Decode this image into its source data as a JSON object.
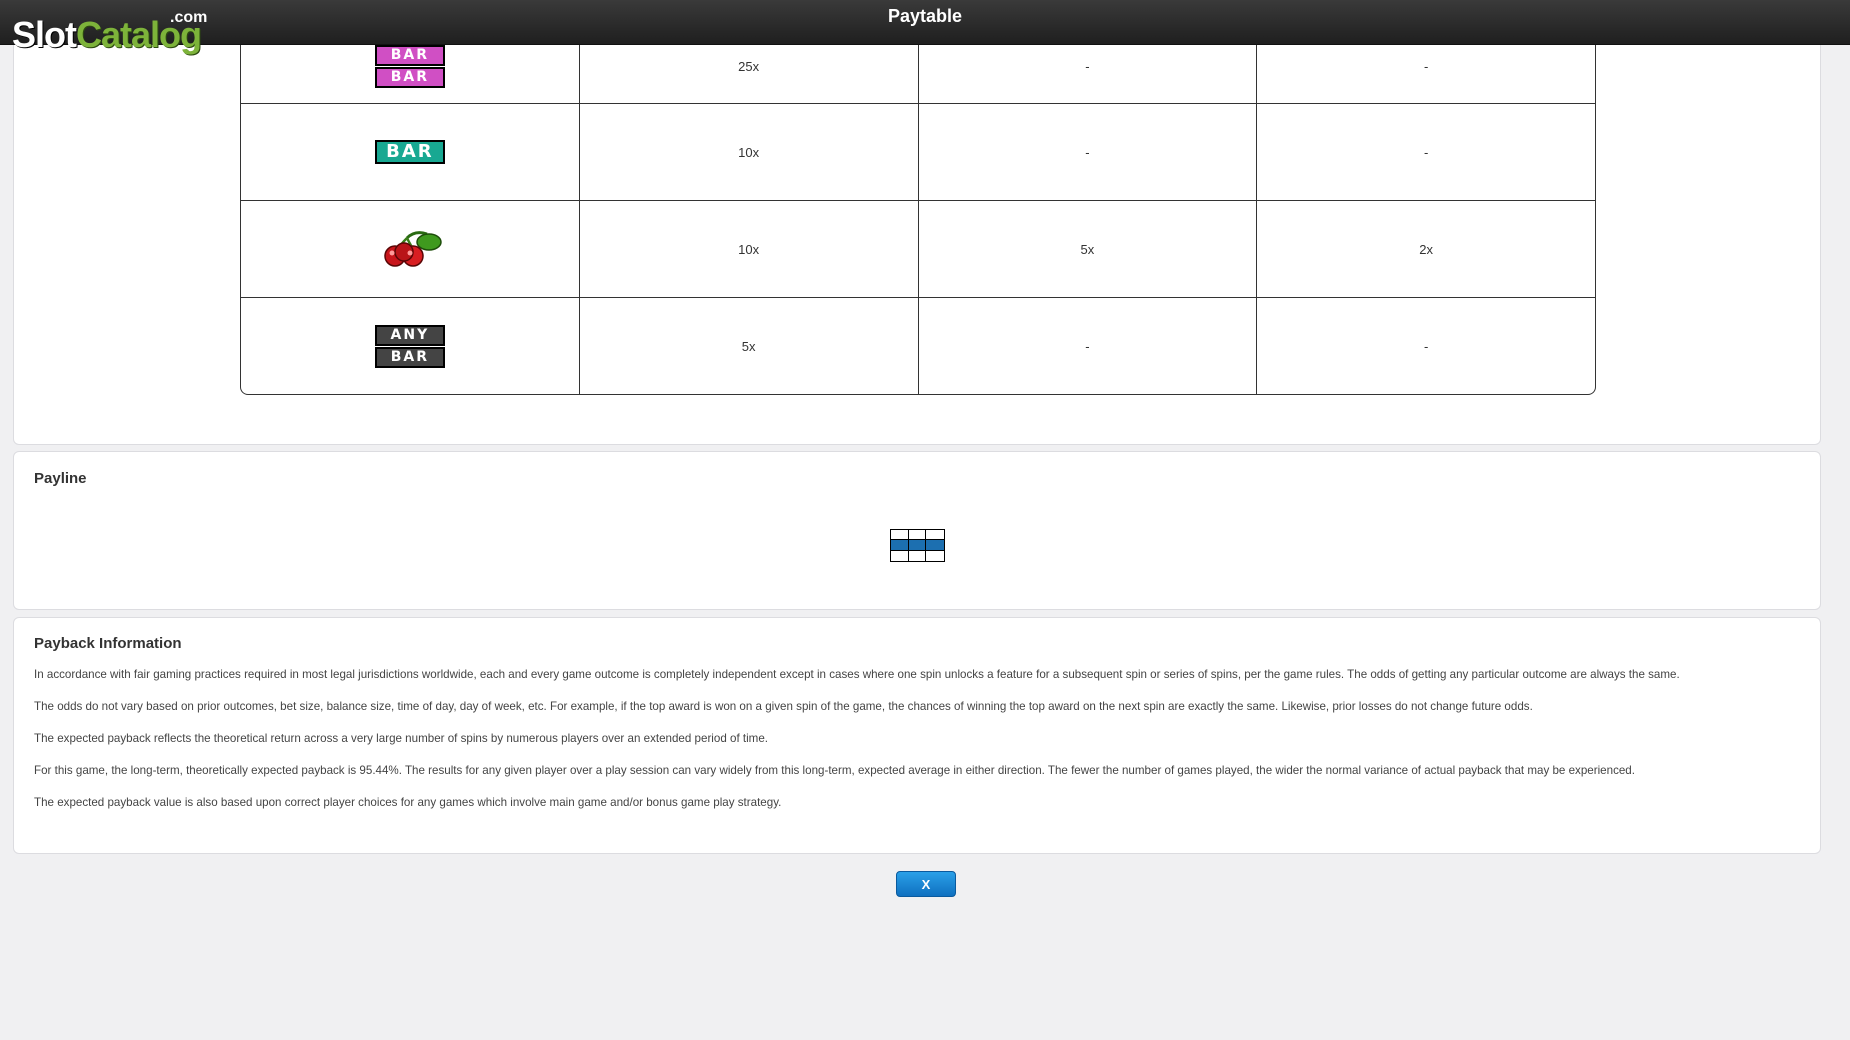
{
  "header": {
    "title": "Paytable"
  },
  "logo": {
    "dotcom": ".com",
    "slot": "Slot",
    "catalog": "Catalog"
  },
  "paytable": {
    "rows": [
      {
        "symbol": "double-bar-icon",
        "symbol_text": [
          "BAR",
          "BAR"
        ],
        "pays": [
          "25x",
          "-",
          "-"
        ]
      },
      {
        "symbol": "single-bar-icon",
        "symbol_text": [
          "BAR"
        ],
        "pays": [
          "10x",
          "-",
          "-"
        ]
      },
      {
        "symbol": "cherries-icon",
        "symbol_text": [],
        "pays": [
          "10x",
          "5x",
          "2x"
        ]
      },
      {
        "symbol": "any-bar-icon",
        "symbol_text": [
          "ANY",
          "BAR"
        ],
        "pays": [
          "5x",
          "-",
          "-"
        ]
      }
    ]
  },
  "payline": {
    "title": "Payline",
    "highlighted_row": 2
  },
  "payback": {
    "title": "Payback Information",
    "paragraphs": [
      "In accordance with fair gaming practices required in most legal jurisdictions worldwide, each and every game outcome is completely independent except in cases where one spin unlocks a feature for a subsequent spin or series of spins, per the game rules. The odds of getting any particular outcome are always the same.",
      "The odds do not vary based on prior outcomes, bet size, balance size, time of day, day of week, etc. For example, if the top award is won on a given spin of the game, the chances of winning the top award on the next spin are exactly the same. Likewise, prior losses do not change future odds.",
      "The expected payback reflects the theoretical return across a very large number of spins by numerous players over an extended period of time.",
      "For this game, the long-term, theoretically expected payback is 95.44%. The results for any given player over a play session can vary widely from this long-term, expected average in either direction. The fewer the number of games played, the wider the normal variance of actual payback that may be experienced.",
      "The expected payback value is also based upon correct player choices for any games which involve main game and/or bonus game play strategy."
    ]
  },
  "close_button": {
    "label": "X"
  },
  "colors": {
    "accent": "#1c6fb0",
    "bar_pink": "#d04fc4",
    "bar_teal": "#18a892",
    "logo_green": "#7db33a"
  }
}
